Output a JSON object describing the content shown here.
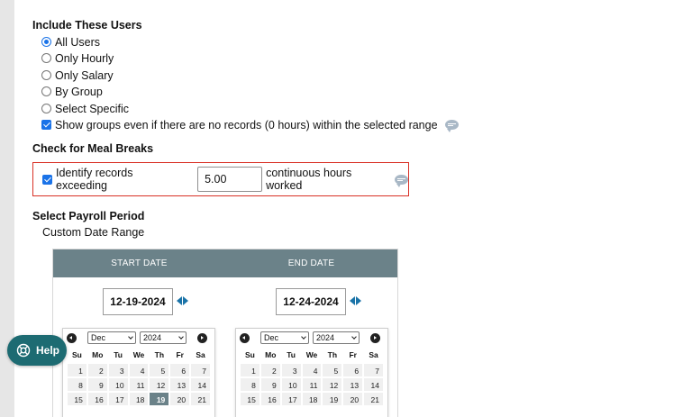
{
  "include_users": {
    "heading": "Include These Users",
    "options": [
      {
        "label": "All Users",
        "selected": true
      },
      {
        "label": "Only Hourly",
        "selected": false
      },
      {
        "label": "Only Salary",
        "selected": false
      },
      {
        "label": "By Group",
        "selected": false
      },
      {
        "label": "Select Specific",
        "selected": false
      }
    ],
    "show_groups_label": "Show groups even if there are no records (0 hours) within the selected range",
    "show_groups_checked": true
  },
  "meal_breaks": {
    "heading": "Check for Meal Breaks",
    "identify_label": "Identify records exceeding",
    "identify_checked": true,
    "hours_value": "5.00",
    "suffix_label": "continuous hours worked"
  },
  "payroll": {
    "heading": "Select Payroll Period",
    "range_label": "Custom Date Range",
    "start_header": "START DATE",
    "end_header": "END DATE",
    "start_value": "12-19-2024",
    "end_value": "12-24-2024"
  },
  "calendar_start": {
    "month": "Dec",
    "year": "2024",
    "weekdays": [
      "Su",
      "Mo",
      "Tu",
      "We",
      "Th",
      "Fr",
      "Sa"
    ],
    "days": [
      "1",
      "2",
      "3",
      "4",
      "5",
      "6",
      "7",
      "8",
      "9",
      "10",
      "11",
      "12",
      "13",
      "14",
      "15",
      "16",
      "17",
      "18",
      "19",
      "20",
      "21"
    ],
    "selected_day": "19"
  },
  "calendar_end": {
    "month": "Dec",
    "year": "2024",
    "weekdays": [
      "Su",
      "Mo",
      "Tu",
      "We",
      "Th",
      "Fr",
      "Sa"
    ],
    "days": [
      "1",
      "2",
      "3",
      "4",
      "5",
      "6",
      "7",
      "8",
      "9",
      "10",
      "11",
      "12",
      "13",
      "14",
      "15",
      "16",
      "17",
      "18",
      "19",
      "20",
      "21"
    ],
    "selected_day": ""
  },
  "help": {
    "label": "Help"
  },
  "colors": {
    "accent": "#1a73e8",
    "header_bg": "#6b8289",
    "highlight_border": "#d93025",
    "help_bg": "#1d6b72"
  }
}
